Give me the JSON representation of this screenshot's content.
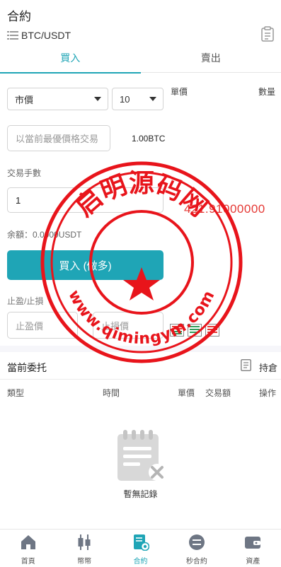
{
  "header": {
    "title": "合約",
    "pair": "BTC/USDT"
  },
  "tabs": [
    {
      "label": "買入",
      "active": true
    },
    {
      "label": "賣出",
      "active": false
    }
  ],
  "form": {
    "order_type": "市價",
    "leverage": "10",
    "unit_price_label": "單價",
    "quantity_label": "數量",
    "market_price_placeholder": "以當前最優價格交易",
    "btc_amount": "1.00BTC",
    "trade_lots_label": "交易手數",
    "lots_value": "1",
    "current_price": "421.91000000",
    "balance_label": "余額：0.0000USDT",
    "buy_button": "買入 (做多)",
    "tp_sl_label": "止盈/止損",
    "take_profit_placeholder": "止盈價",
    "stop_loss_placeholder": "止損價"
  },
  "orders": {
    "title": "當前委托",
    "hold_label": "持倉",
    "columns": [
      "類型",
      "時間",
      "單價",
      "交易額",
      "操作"
    ],
    "empty_text": "暫無記錄"
  },
  "nav": [
    {
      "label": "首頁",
      "icon": "home-icon",
      "active": false
    },
    {
      "label": "幣幣",
      "icon": "candlestick-icon",
      "active": false
    },
    {
      "label": "合約",
      "icon": "contract-icon",
      "active": true
    },
    {
      "label": "秒合約",
      "icon": "swap-coin-icon",
      "active": false
    },
    {
      "label": "資產",
      "icon": "wallet-icon",
      "active": false
    }
  ],
  "watermark": {
    "top_text": "启明源码网",
    "bottom_text": "www.qimingym.com",
    "color": "#e8141b"
  },
  "colors": {
    "accent": "#1fa5b6",
    "price": "#e53935"
  }
}
